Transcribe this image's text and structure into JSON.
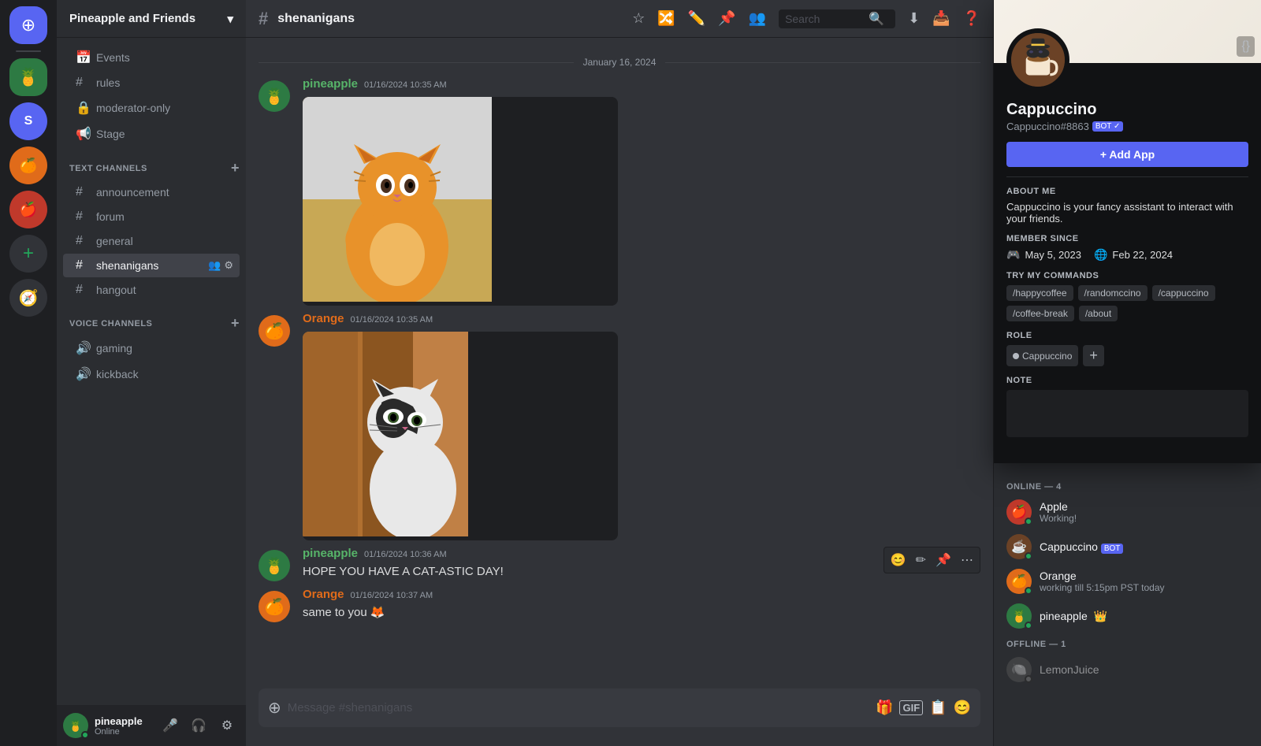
{
  "app": {
    "title": "Pineapple and Friends"
  },
  "server": {
    "name": "Pineapple and Friends",
    "channel": "shenanigans"
  },
  "sidebar": {
    "special_items": [
      {
        "label": "Events",
        "icon": "📅"
      }
    ],
    "text_channels_header": "TEXT CHANNELS",
    "text_channels": [
      {
        "id": "rules",
        "label": "rules",
        "icon": "#"
      },
      {
        "id": "moderator-only",
        "label": "moderator-only",
        "icon": "🔒"
      },
      {
        "id": "stage",
        "label": "Stage",
        "icon": "🎭"
      },
      {
        "id": "announcement",
        "label": "announcement",
        "icon": "#"
      },
      {
        "id": "forum",
        "label": "forum",
        "icon": "#"
      },
      {
        "id": "general",
        "label": "general",
        "icon": "#"
      },
      {
        "id": "shenanigans",
        "label": "shenanigans",
        "icon": "#",
        "active": true
      },
      {
        "id": "hangout",
        "label": "hangout",
        "icon": "#"
      }
    ],
    "voice_channels_header": "VOICE CHANNELS",
    "voice_channels": [
      {
        "id": "gaming",
        "label": "gaming",
        "icon": "🔊"
      },
      {
        "id": "kickback",
        "label": "kickback",
        "icon": "🔊"
      }
    ],
    "footer_user": {
      "name": "pineapple",
      "status": "Online"
    }
  },
  "chat": {
    "channel_name": "shenanigans",
    "input_placeholder": "Message #shenanigans",
    "date_separator": "January 16, 2024",
    "messages": [
      {
        "id": "msg1",
        "author": "pineapple",
        "author_color": "pineapple",
        "timestamp": "01/16/2024 10:35 AM",
        "image": true,
        "image_type": "cat1"
      },
      {
        "id": "msg2",
        "author": "Orange",
        "author_color": "orange",
        "timestamp": "01/16/2024 10:35 AM",
        "image": true,
        "image_type": "cat2"
      },
      {
        "id": "msg3",
        "author": "pineapple",
        "author_color": "pineapple",
        "timestamp": "01/16/2024 10:36 AM",
        "text": "HOPE YOU HAVE A CAT-ASTIC DAY!"
      },
      {
        "id": "msg4",
        "author": "Orange",
        "author_color": "orange",
        "timestamp": "01/16/2024 10:37 AM",
        "text": "same to you 🦊"
      }
    ]
  },
  "members": {
    "online_header": "ONLINE — 4",
    "online_count": 4,
    "offline_header": "OFFLINE — 1",
    "offline_count": 1,
    "online_members": [
      {
        "name": "Apple",
        "status_text": "Working!",
        "color": "member-apple",
        "emoji": "🍎"
      },
      {
        "name": "Cappuccino",
        "status_text": "",
        "color": "member-cappuccino",
        "emoji": "☕",
        "is_bot": true
      },
      {
        "name": "Orange",
        "status_text": "working till 5:15pm PST today",
        "color": "member-orange",
        "emoji": "🍊"
      },
      {
        "name": "pineapple",
        "status_text": "",
        "color": "member-pineapple",
        "emoji": "🍍",
        "has_crown": true
      }
    ],
    "offline_members": [
      {
        "name": "LemonJuice",
        "color": "member-lemon",
        "emoji": "🍋"
      }
    ]
  },
  "profile": {
    "name": "Cappuccino",
    "discriminator": "Cappuccino#8863",
    "is_bot": true,
    "add_app_label": "+ Add App",
    "about_me_title": "ABOUT ME",
    "about_me_text": "Cappuccino is your fancy assistant to interact with your friends.",
    "member_since_title": "MEMBER SINCE",
    "discord_date": "May 5, 2023",
    "server_date": "Feb 22, 2024",
    "commands_title": "TRY MY COMMANDS",
    "commands": [
      "/happycoffee",
      "/randomccino",
      "/cappuccino",
      "/coffee-break",
      "/about"
    ],
    "role_title": "ROLE",
    "roles": [
      "Cappuccino"
    ],
    "note_title": "NOTE",
    "note_placeholder": ""
  },
  "search": {
    "placeholder": "Search"
  },
  "colors": {
    "accent": "#5865f2",
    "online": "#23a55a",
    "offline": "#80848e",
    "pineapple_name": "#57b469",
    "orange_name": "#e06b1a"
  }
}
